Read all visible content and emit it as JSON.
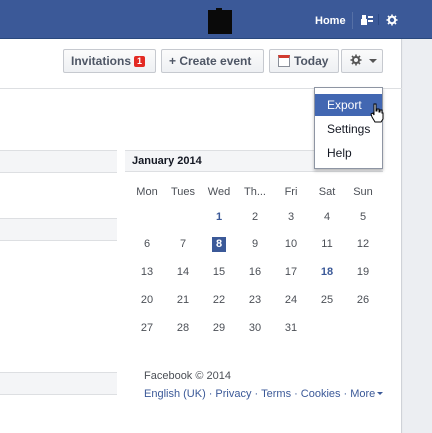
{
  "topbar": {
    "home_label": "Home",
    "icons": [
      "profile-avatar",
      "friends-icon",
      "settings-icon"
    ]
  },
  "toolbar": {
    "invitations_label": "Invitations",
    "invitations_count": "1",
    "create_event_label": "+ Create event",
    "today_label": "Today",
    "gear_icon": "gear-icon",
    "caret_icon": "chevron-down-icon"
  },
  "menu": {
    "items": [
      "Export",
      "Settings",
      "Help"
    ],
    "highlighted": "Export"
  },
  "calendar": {
    "month_label": "January 2014",
    "weekdays": [
      "Mon",
      "Tues",
      "Wed",
      "Th...",
      "Fri",
      "Sat",
      "Sun"
    ],
    "weeks": [
      [
        "",
        "",
        "1",
        "2",
        "3",
        "4",
        "5"
      ],
      [
        "6",
        "7",
        "8",
        "9",
        "10",
        "11",
        "12"
      ],
      [
        "13",
        "14",
        "15",
        "16",
        "17",
        "18",
        "19"
      ],
      [
        "20",
        "21",
        "22",
        "23",
        "24",
        "25",
        "26"
      ],
      [
        "27",
        "28",
        "29",
        "30",
        "31",
        "",
        ""
      ]
    ],
    "today": "8",
    "bold_days": [
      "1",
      "18"
    ]
  },
  "footer": {
    "copyright": "Facebook © 2014",
    "links": [
      "English (UK)",
      "Privacy",
      "Terms",
      "Cookies",
      "More"
    ]
  },
  "colors": {
    "brand": "#3b5998",
    "badge": "#e32a23",
    "menu_highlight": "#4267b2"
  }
}
